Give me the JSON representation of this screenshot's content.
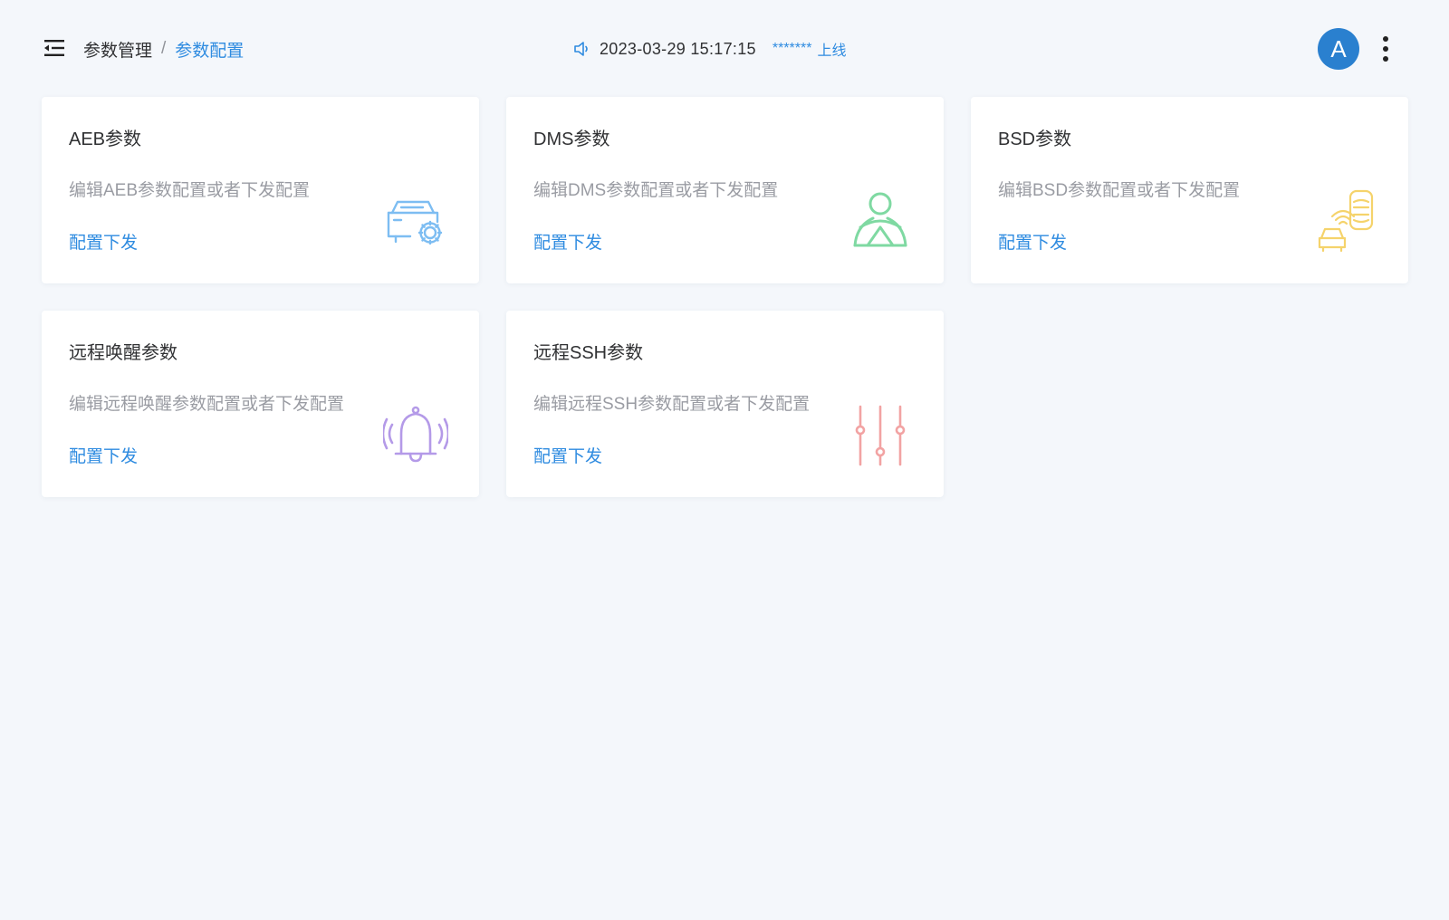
{
  "header": {
    "breadcrumb": {
      "parent": "参数管理",
      "separator": "/",
      "current": "参数配置"
    },
    "status": {
      "datetime": "2023-03-29 15:17:15",
      "device": "*******",
      "online": "上线"
    },
    "avatar_letter": "A"
  },
  "cards": [
    {
      "title": "AEB参数",
      "desc": "编辑AEB参数配置或者下发配置",
      "link": "配置下发",
      "icon": "car-settings-icon",
      "color": "#7dbdf2"
    },
    {
      "title": "DMS参数",
      "desc": "编辑DMS参数配置或者下发配置",
      "link": "配置下发",
      "icon": "driver-icon",
      "color": "#7fd9a2"
    },
    {
      "title": "BSD参数",
      "desc": "编辑BSD参数配置或者下发配置",
      "link": "配置下发",
      "icon": "blind-spot-icon",
      "color": "#f5d36b"
    },
    {
      "title": "远程唤醒参数",
      "desc": "编辑远程唤醒参数配置或者下发配置",
      "link": "配置下发",
      "icon": "bell-ring-icon",
      "color": "#b49ae8"
    },
    {
      "title": "远程SSH参数",
      "desc": "编辑远程SSH参数配置或者下发配置",
      "link": "配置下发",
      "icon": "sliders-icon",
      "color": "#f2a3a3"
    }
  ],
  "colors": {
    "accent": "#2e8be0",
    "background": "#f4f7fb",
    "avatar": "#2a80cf"
  }
}
